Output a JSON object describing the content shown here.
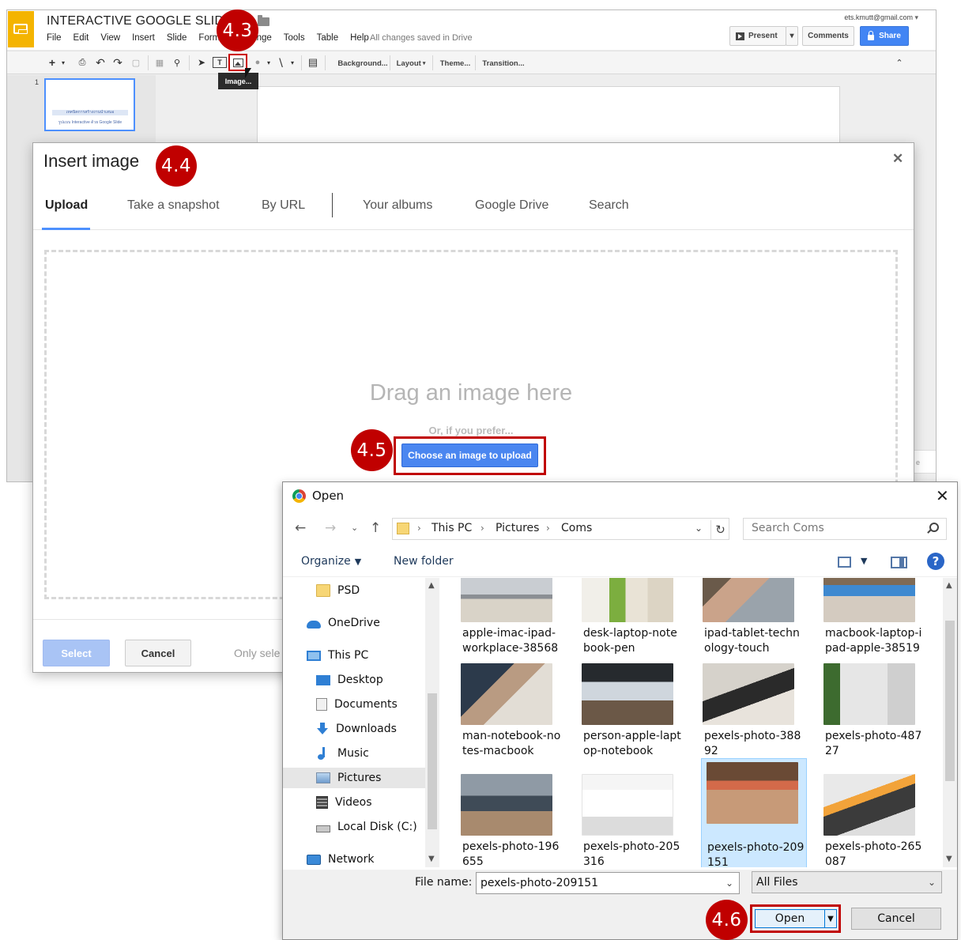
{
  "slides_app": {
    "doc_title": "INTERACTIVE GOOGLE SLIDE",
    "menu": [
      "File",
      "Edit",
      "View",
      "Insert",
      "Slide",
      "Format",
      "Arrange",
      "Tools",
      "Table",
      "Help"
    ],
    "saved_status": "All changes saved in Drive",
    "account": "ets.kmutt@gmail.com",
    "present_label": "Present",
    "comments_label": "Comments",
    "share_label": "Share",
    "toolbar": {
      "background_label": "Background...",
      "layout_label": "Layout",
      "theme_label": "Theme...",
      "transition_label": "Transition...",
      "image_tooltip": "Image..."
    },
    "slide_number": "1",
    "thumb_line1": "เทคนิคการสร้างงานนำเสนอ",
    "thumb_line2": "รูปแบบ Interactive ด้วย Google Slide"
  },
  "badges": {
    "b43": "4.3",
    "b44": "4.4",
    "b45": "4.5",
    "b46": "4.6"
  },
  "insert_dialog": {
    "title": "Insert image",
    "tabs": [
      "Upload",
      "Take a snapshot",
      "By URL",
      "Your albums",
      "Google Drive",
      "Search"
    ],
    "drag_text": "Drag an image here",
    "prefer_text": "Or, if you prefer...",
    "choose_button": "Choose an image to upload",
    "select_button": "Select",
    "cancel_button": "Cancel",
    "only_text": "Only sele"
  },
  "open_dialog": {
    "title": "Open",
    "breadcrumb": [
      "This PC",
      "Pictures",
      "Coms"
    ],
    "search_placeholder": "Search Coms",
    "organize_label": "Organize",
    "new_folder_label": "New folder",
    "nav_items": [
      {
        "label": "PSD",
        "icon": "folder-icon"
      },
      {
        "label": "OneDrive",
        "icon": "cloud-icon"
      },
      {
        "label": "This PC",
        "icon": "computer-icon"
      },
      {
        "label": "Desktop",
        "icon": "desktop-icon"
      },
      {
        "label": "Documents",
        "icon": "documents-icon"
      },
      {
        "label": "Downloads",
        "icon": "downloads-icon"
      },
      {
        "label": "Music",
        "icon": "music-icon"
      },
      {
        "label": "Pictures",
        "icon": "pictures-icon"
      },
      {
        "label": "Videos",
        "icon": "videos-icon"
      },
      {
        "label": "Local Disk (C:)",
        "icon": "disk-icon"
      },
      {
        "label": "Network",
        "icon": "network-icon"
      }
    ],
    "files": [
      {
        "name": "apple-imac-ipad-workplace-38568"
      },
      {
        "name": "desk-laptop-notebook-pen"
      },
      {
        "name": "ipad-tablet-technology-touch"
      },
      {
        "name": "macbook-laptop-ipad-apple-38519"
      },
      {
        "name": "man-notebook-notes-macbook"
      },
      {
        "name": "person-apple-laptop-notebook"
      },
      {
        "name": "pexels-photo-38892"
      },
      {
        "name": "pexels-photo-48727"
      },
      {
        "name": "pexels-photo-196655"
      },
      {
        "name": "pexels-photo-205316"
      },
      {
        "name": "pexels-photo-209151"
      },
      {
        "name": "pexels-photo-265087"
      }
    ],
    "file_name_label": "File name:",
    "file_name_value": "pexels-photo-209151",
    "file_type": "All Files",
    "open_button": "Open",
    "cancel_button": "Cancel"
  }
}
